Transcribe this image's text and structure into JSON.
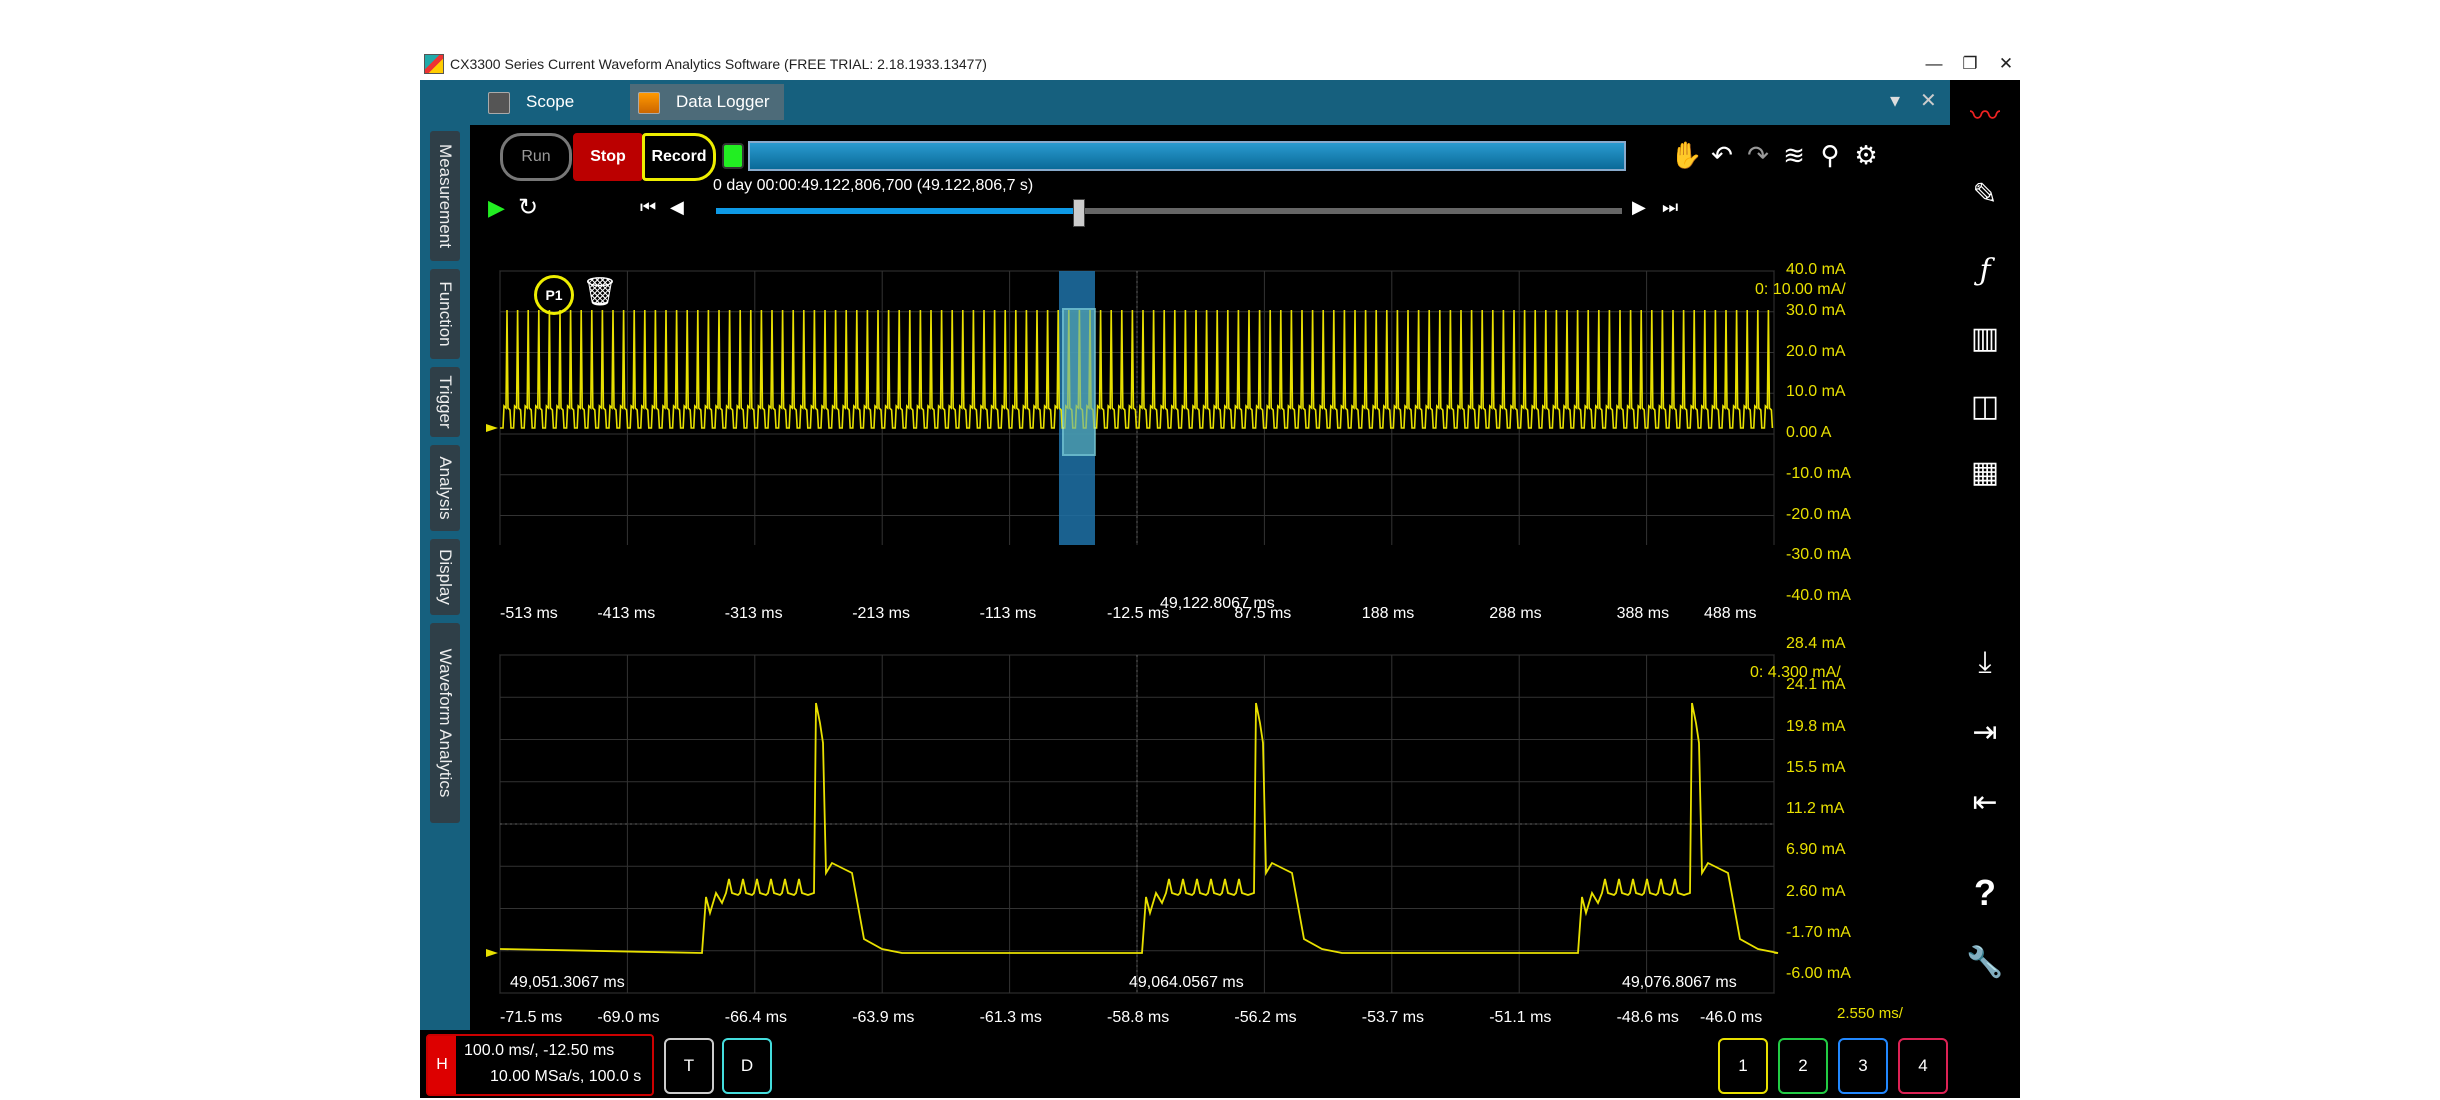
{
  "window": {
    "title": "CX3300 Series Current Waveform Analytics Software (FREE TRIAL: 2.18.1933.13477)",
    "minimize": "—",
    "restore": "❐",
    "close": "✕"
  },
  "tabs": [
    {
      "label": "Scope"
    },
    {
      "label": "Data Logger"
    }
  ],
  "tabstrip": {
    "dropdown": "▾",
    "close": "✕"
  },
  "sidebar": {
    "items": [
      {
        "label": "Measurement"
      },
      {
        "label": "Function"
      },
      {
        "label": "Trigger"
      },
      {
        "label": "Analysis"
      },
      {
        "label": "Display"
      },
      {
        "label": "Waveform Analytics"
      }
    ]
  },
  "controls": {
    "run": "Run",
    "stop": "Stop",
    "record": "Record",
    "timestamp": "0 day 00:00:49.122,806,700 (49.122,806,7 s)",
    "scrub_position": 0.4
  },
  "toolbar_icons": [
    "hand-icon",
    "undo-icon",
    "redo-icon",
    "waveform-icon",
    "marker-icon",
    "gear-icon"
  ],
  "right_icons": [
    "brand-logo-icon",
    "probe-icon",
    "function-icon",
    "histogram-icon",
    "layout-icon",
    "table-icon",
    "download-icon",
    "import-icon",
    "export-icon",
    "help-icon",
    "tools-icon"
  ],
  "plot1": {
    "badge": "P1",
    "scale_label": "0:  10.00 mA/",
    "cursor_time": "49,122.8067 ms",
    "x_ticks": [
      "-513 ms",
      "-413 ms",
      "-313 ms",
      "-213 ms",
      "-113 ms",
      "-12.5 ms",
      "87.5 ms",
      "188 ms",
      "288 ms",
      "388 ms",
      "488 ms"
    ],
    "y_ticks": [
      "40.0 mA",
      "30.0 mA",
      "20.0 mA",
      "10.0 mA",
      "0.00 A",
      "-10.0 mA",
      "-20.0 mA",
      "-30.0 mA",
      "-40.0 mA"
    ]
  },
  "plot2": {
    "scale_label": "0:  4.300 mA/",
    "left_time": "49,051.3067 ms",
    "center_time": "49,064.0567 ms",
    "right_time": "49,076.8067 ms",
    "timebase": "2.550 ms/",
    "x_ticks": [
      "-71.5 ms",
      "-69.0 ms",
      "-66.4 ms",
      "-63.9 ms",
      "-61.3 ms",
      "-58.8 ms",
      "-56.2 ms",
      "-53.7 ms",
      "-51.1 ms",
      "-48.6 ms",
      "-46.0 ms"
    ],
    "y_ticks": [
      "28.4 mA",
      "24.1 mA",
      "19.8 mA",
      "15.5 mA",
      "11.2 mA",
      "6.90 mA",
      "2.60 mA",
      "-1.70 mA",
      "-6.00 mA"
    ]
  },
  "horizontal": {
    "badge": "H",
    "line1": "100.0 ms/, -12.50 ms",
    "line2": "10.00 MSa/s, 100.0 s"
  },
  "bottom_buttons": {
    "t": "T",
    "d": "D",
    "ch1": "1",
    "ch2": "2",
    "ch3": "3",
    "ch4": "4"
  },
  "colors": {
    "trace": "#e8e000",
    "accent": "#16607e",
    "stop": "#bb0000",
    "ch2": "#22cc44",
    "ch3": "#2288ff",
    "ch4": "#dd2255"
  }
}
